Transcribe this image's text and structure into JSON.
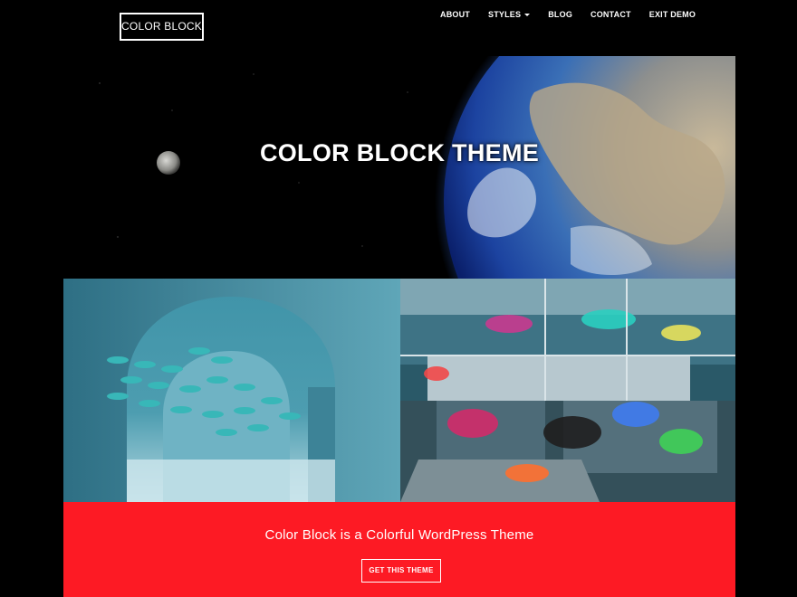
{
  "header": {
    "logo_text": "COLOR BLOCK",
    "nav": [
      {
        "label": "ABOUT",
        "has_dropdown": false
      },
      {
        "label": "STYLES",
        "has_dropdown": true
      },
      {
        "label": "BLOG",
        "has_dropdown": false
      },
      {
        "label": "CONTACT",
        "has_dropdown": false
      },
      {
        "label": "EXIT DEMO",
        "has_dropdown": false
      }
    ]
  },
  "hero": {
    "title": "COLOR BLOCK THEME",
    "image": "earth-and-moon-from-space"
  },
  "blocks": [
    {
      "image": "fish-swimming-through-stone-arches"
    },
    {
      "image": "graffiti-covered-abandoned-building"
    }
  ],
  "cta": {
    "text": "Color Block is a Colorful WordPress Theme",
    "button_label": "GET THIS THEME",
    "background_color": "#fd1a24"
  },
  "colors": {
    "background": "#000000",
    "text": "#ffffff",
    "accent": "#fd1a24"
  }
}
